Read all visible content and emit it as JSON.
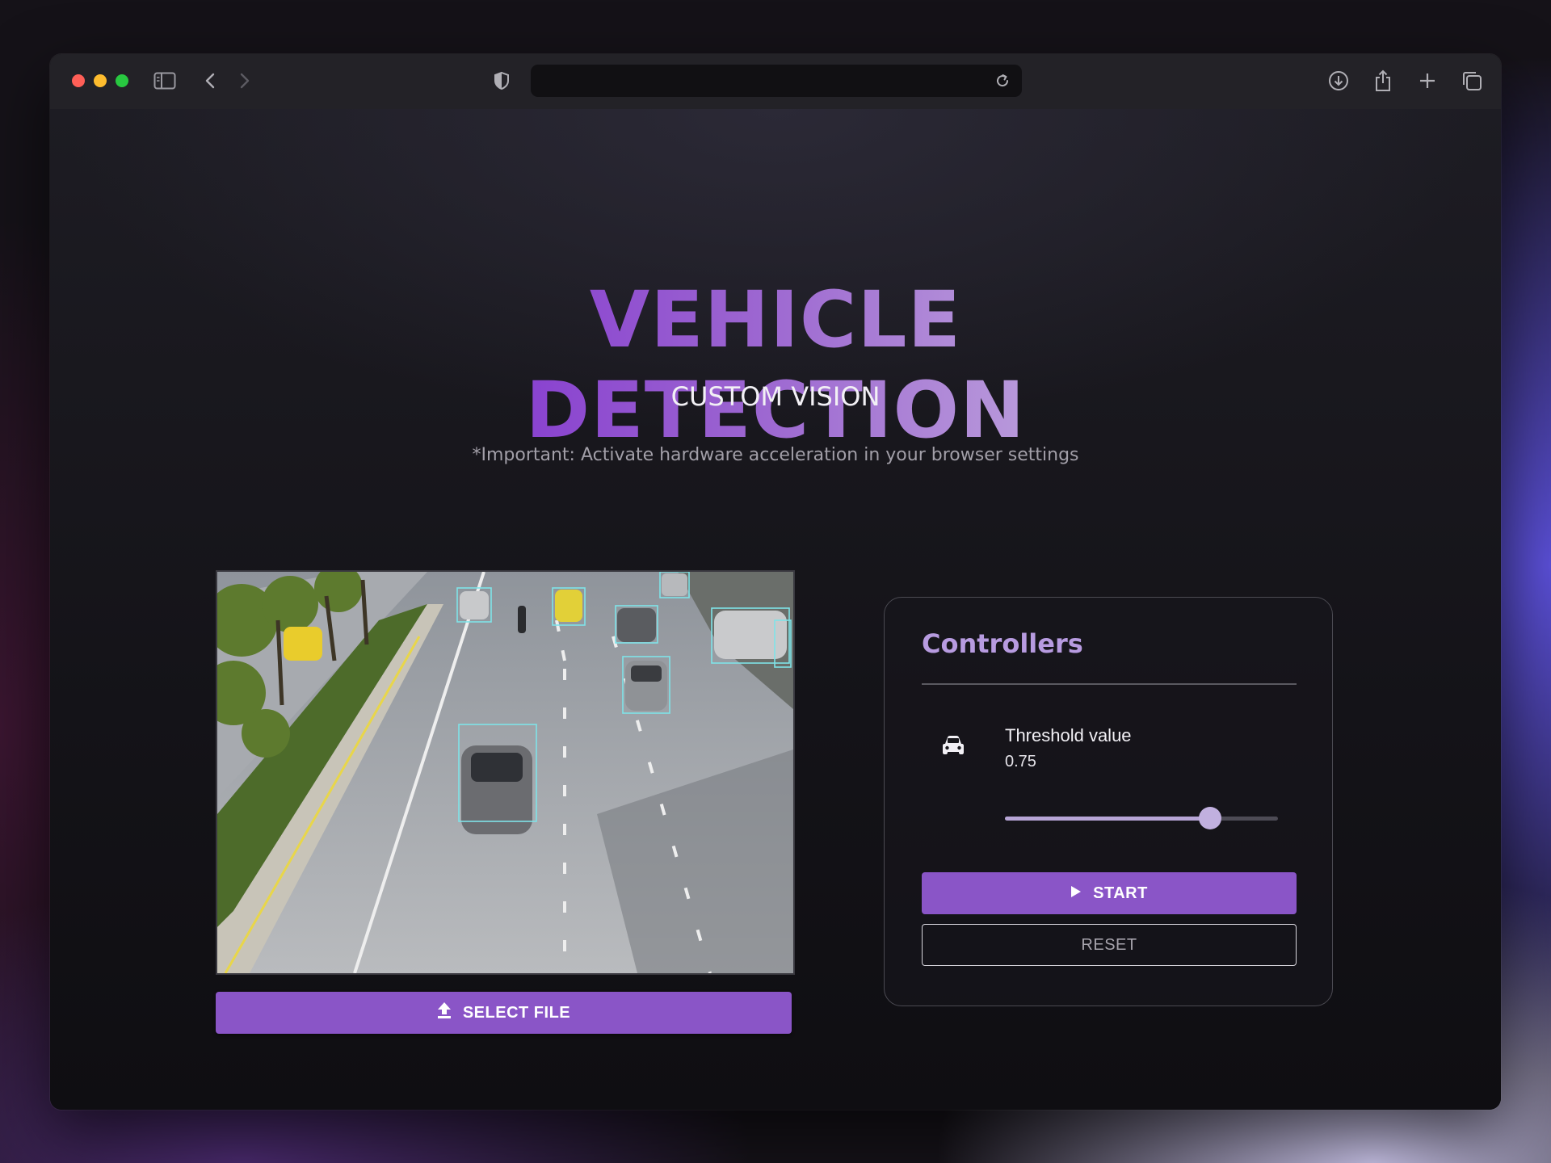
{
  "browser": {
    "address": "",
    "icons": [
      "sidebar-icon",
      "back-icon",
      "forward-icon",
      "shield-icon",
      "reload-icon",
      "download-icon",
      "share-icon",
      "new-tab-icon",
      "tabs-icon"
    ]
  },
  "header": {
    "title": "VEHICLE DETECTION",
    "subtitle": "CUSTOM VISION",
    "notice": "*Important: Activate hardware acceleration in your browser settings"
  },
  "video": {
    "select_label": "SELECT FILE",
    "detections_count": 8
  },
  "controllers": {
    "title": "Controllers",
    "threshold_label": "Threshold value",
    "threshold_value": "0.75",
    "threshold_fraction": 0.75,
    "start_label": "START",
    "reset_label": "RESET"
  },
  "colors": {
    "accent": "#8a55c7",
    "title_gradient_start": "#7d2bd0",
    "title_gradient_end": "#c8b6e0",
    "panel_title": "#b79be0",
    "detection_box": "#7fe3e8"
  }
}
